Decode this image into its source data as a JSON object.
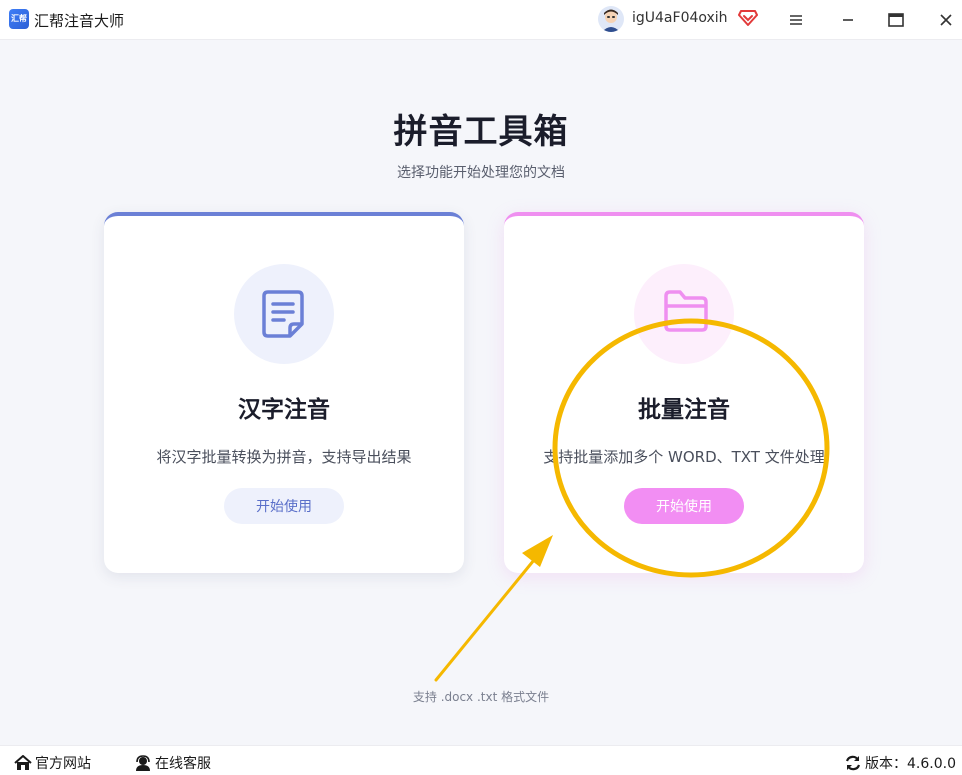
{
  "titlebar": {
    "app_title": "汇帮注音大师",
    "logo_text": "汇帮",
    "username": "igU4aF04oxih"
  },
  "header": {
    "title": "拼音工具箱",
    "subtitle": "选择功能开始处理您的文档"
  },
  "cards": [
    {
      "title": "汉字注音",
      "description": "将汉字批量转换为拼音，支持导出结果",
      "button_label": "开始使用",
      "accent_color": "#6b80d6"
    },
    {
      "title": "批量注音",
      "description": "支持批量添加多个 WORD、TXT 文件处理",
      "button_label": "开始使用",
      "accent_color": "#ef8ff0"
    }
  ],
  "footnote": "支持 .docx .txt 格式文件",
  "statusbar": {
    "official_site": "官方网站",
    "online_service": "在线客服",
    "version": "版本：4.6.0.0"
  },
  "colors": {
    "annotation": "#f5b800"
  }
}
